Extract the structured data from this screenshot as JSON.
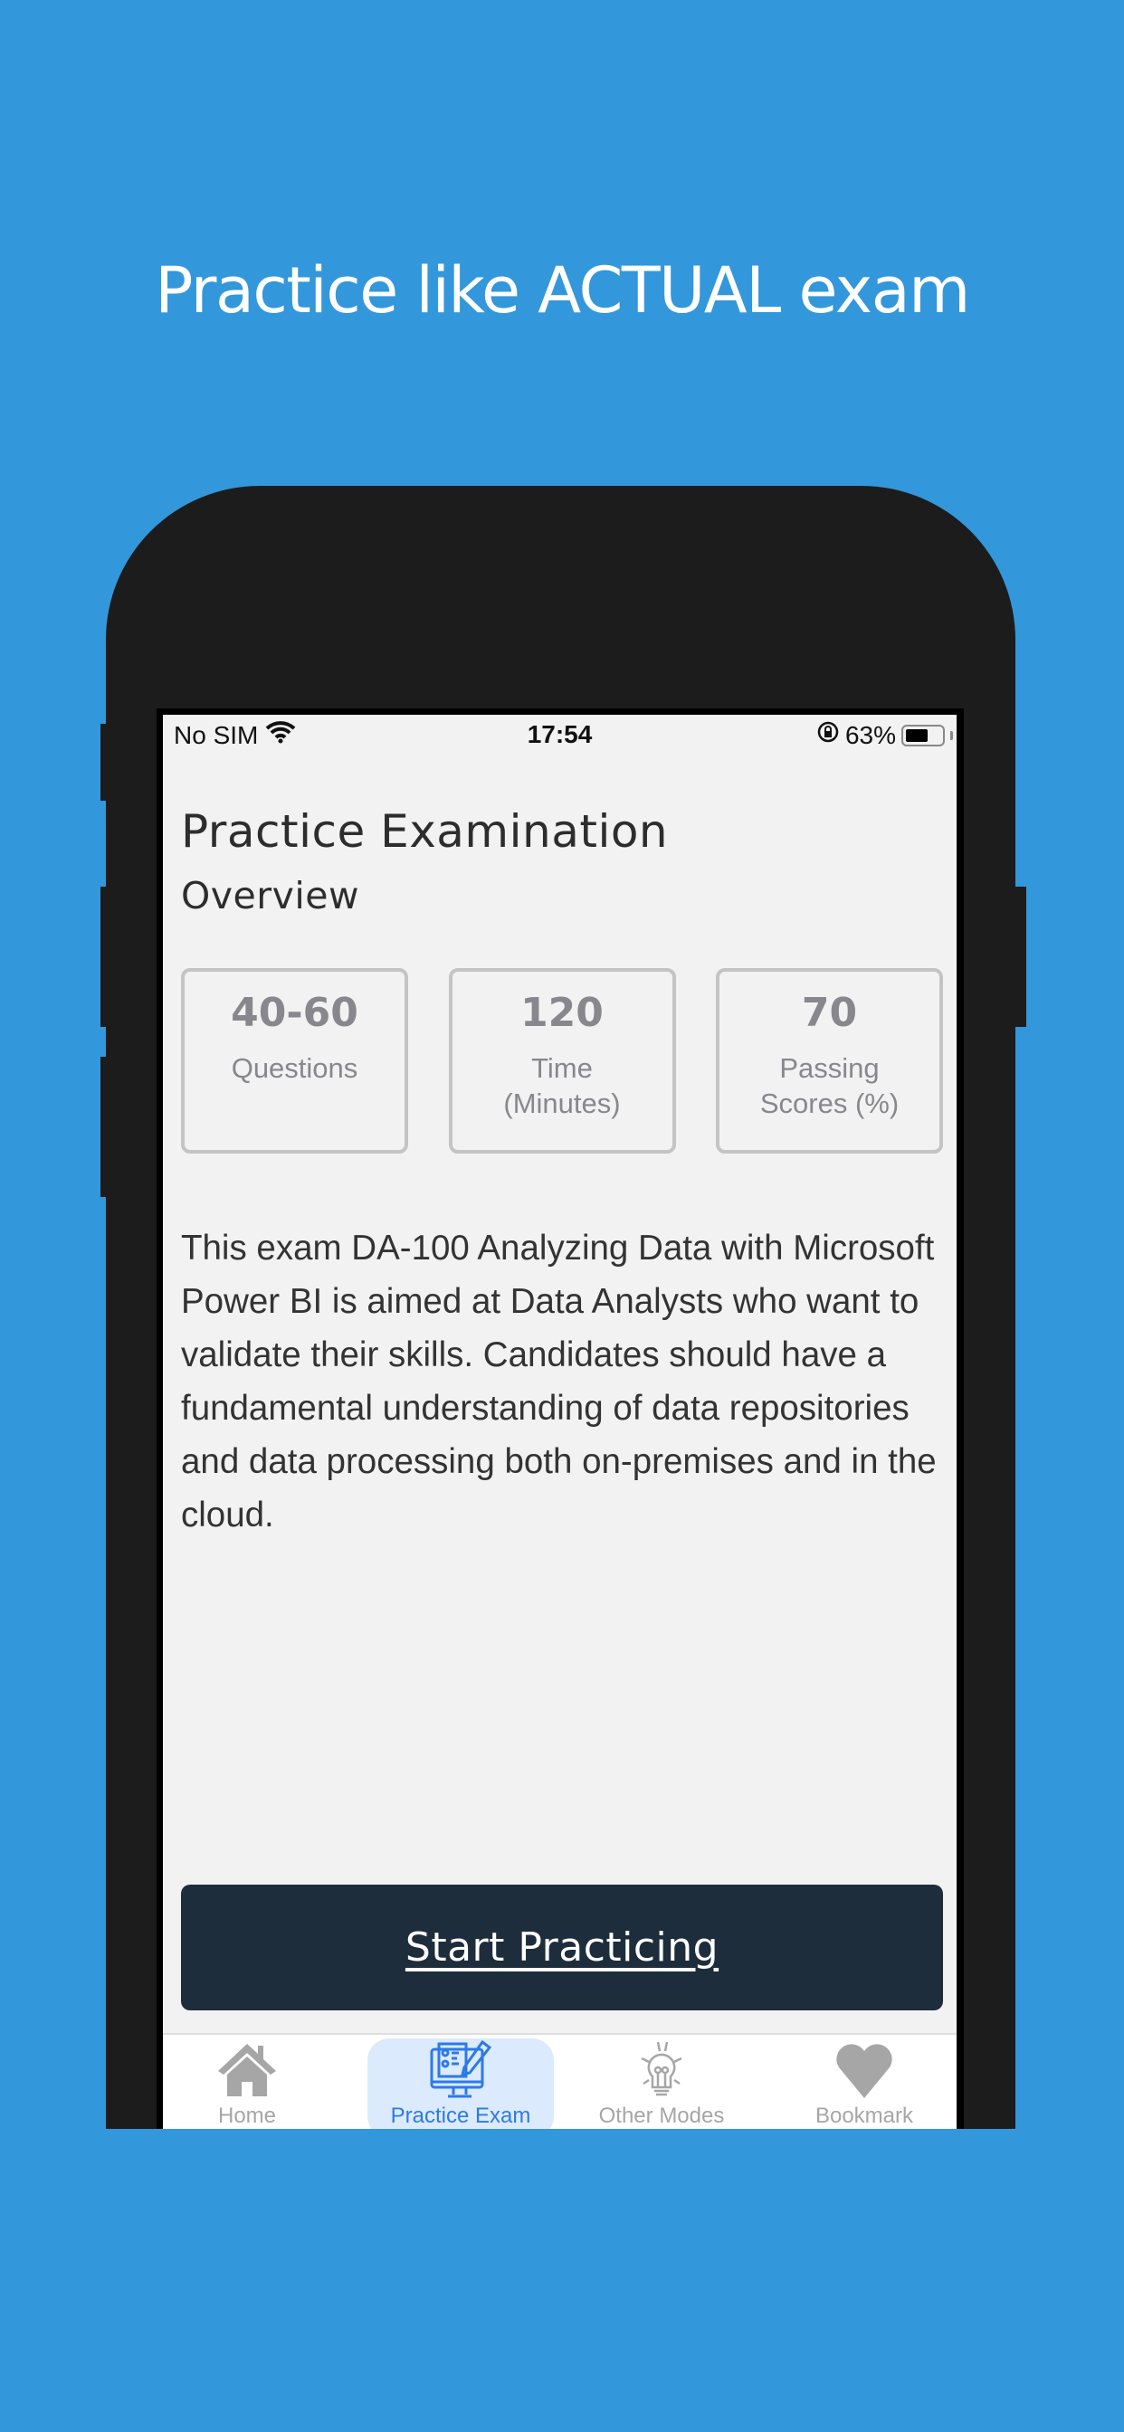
{
  "headline": "Practice like ACTUAL exam",
  "status_bar": {
    "carrier": "No SIM",
    "time": "17:54",
    "battery_percent": "63%",
    "battery_level": 0.63,
    "icons": [
      "wifi-icon",
      "orientation-lock-icon",
      "battery-icon"
    ]
  },
  "page": {
    "title": "Practice Examination",
    "subtitle": "Overview",
    "stats": [
      {
        "value": "40-60",
        "label": "Questions"
      },
      {
        "value": "120",
        "label": "Time\n(Minutes)"
      },
      {
        "value": "70",
        "label": "Passing\nScores (%)"
      }
    ],
    "description": "This exam DA-100 Analyzing Data with Microsoft Power BI is aimed at Data Analysts who want to validate their skills. Candidates should have a fundamental understanding of data repositories and data processing both on-premises and in the cloud.",
    "start_button": "Start Practicing"
  },
  "tabbar": {
    "items": [
      {
        "label": "Home",
        "icon": "home-icon",
        "active": false
      },
      {
        "label": "Practice Exam",
        "icon": "practice-exam-icon",
        "active": true
      },
      {
        "label": "Other Modes",
        "icon": "lightbulb-icon",
        "active": false
      },
      {
        "label": "Bookmark",
        "icon": "heart-icon",
        "active": false
      }
    ]
  },
  "colors": {
    "background": "#3397db",
    "button": "#1e2d3b",
    "active_tab": "#2d7ae6",
    "active_tab_bg": "#dceafd",
    "inactive_tab": "#a6a6a6"
  }
}
